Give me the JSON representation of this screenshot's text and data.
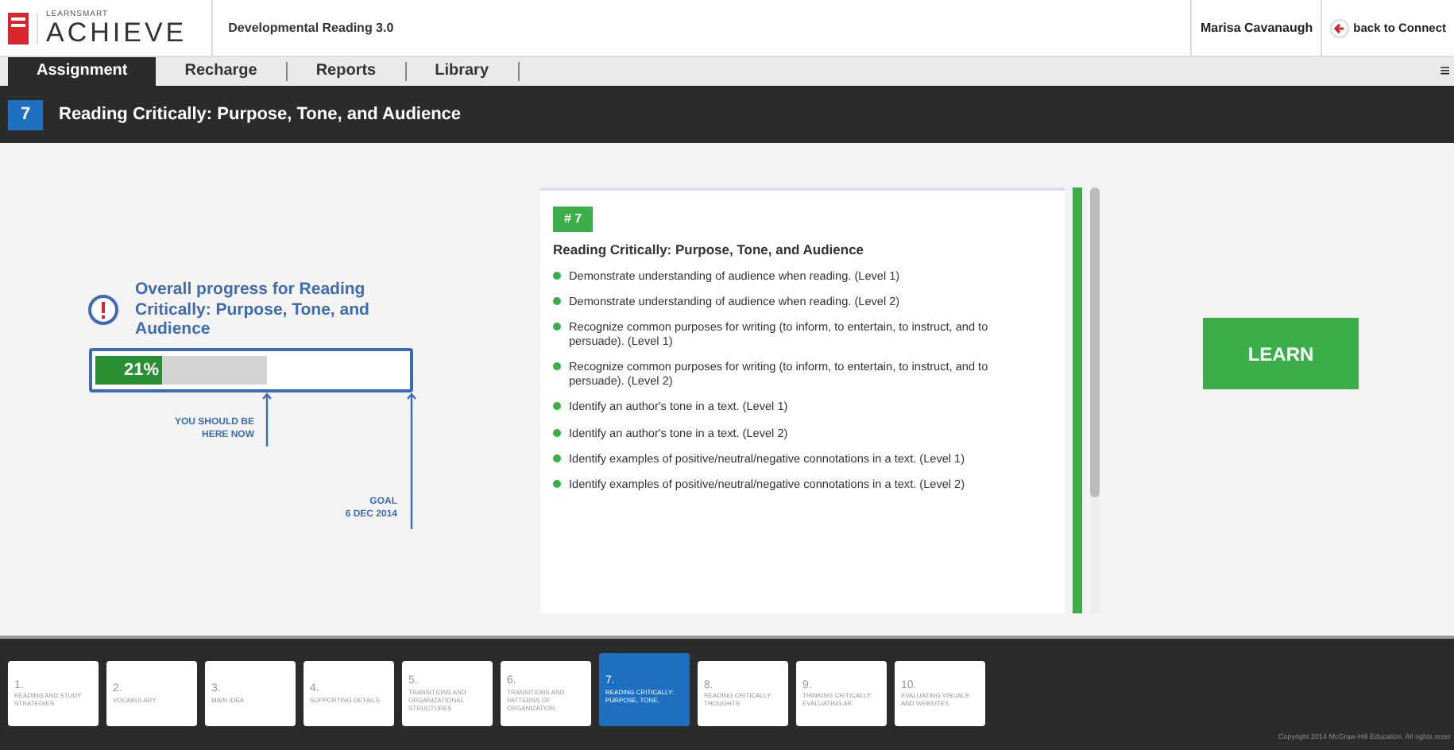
{
  "header": {
    "brand_small": "LEARNSMART",
    "brand": "ACHIEVE",
    "course": "Developmental Reading 3.0",
    "user": "Marisa Cavanaugh",
    "back_link": "back to Connect"
  },
  "tabs": [
    {
      "label": "Assignment",
      "selected": true
    },
    {
      "label": "Recharge",
      "selected": false
    },
    {
      "label": "Reports",
      "selected": false
    },
    {
      "label": "Library",
      "selected": false
    }
  ],
  "menu_icon": "≡",
  "title_bar": {
    "number": "7",
    "title": "Reading Critically: Purpose, Tone, and Audience"
  },
  "progress": {
    "heading": "Overall progress for Reading Critically: Purpose, Tone, and Audience",
    "label": "21%",
    "level": 0.21,
    "expected": {
      "level": 0.54,
      "label": "YOU SHOULD BE HERE NOW"
    },
    "goal": {
      "label": "GOAL",
      "date": "6 DEC 2014"
    }
  },
  "objectives": {
    "badge": "# 7",
    "title": "Reading Critically: Purpose, Tone, and Audience",
    "items": [
      "Demonstrate understanding of audience when reading. (Level 1)",
      "Demonstrate understanding of audience when reading. (Level 2)",
      "Recognize common purposes for writing (to inform, to entertain, to instruct, and to persuade). (Level 1)",
      "Recognize common purposes for writing (to inform, to entertain, to instruct, and to persuade). (Level 2)",
      "Identify an author's tone in a text. (Level 1)",
      "Identify an author's tone in a text. (Level 2)",
      "Identify examples of positive/neutral/negative connotations in a text. (Level 1)",
      "Identify examples of positive/neutral/negative connotations in a text. (Level 2)"
    ]
  },
  "learn_button": "LEARN",
  "chapters": [
    {
      "number": "1.",
      "title": "READING AND STUDY STRATEGIES",
      "selected": false
    },
    {
      "number": "2.",
      "title": "VOCABULARY",
      "selected": false
    },
    {
      "number": "3.",
      "title": "MAIN IDEA",
      "selected": false
    },
    {
      "number": "4.",
      "title": "SUPPORTING DETAILS",
      "selected": false
    },
    {
      "number": "5.",
      "title": "TRANSITIONS AND ORGANIZATIONAL STRUCTURES",
      "selected": false
    },
    {
      "number": "6.",
      "title": "TRANSITIONS AND PATTERNS OF ORGANIZATION",
      "selected": false
    },
    {
      "number": "7.",
      "title": "READING CRITICALLY: PURPOSE, TONE,",
      "selected": true
    },
    {
      "number": "8.",
      "title": "READING CRITICALLY: THOUGHTS",
      "selected": false
    },
    {
      "number": "9.",
      "title": "THINKING CRITICALLY: EVALUATING AR",
      "selected": false
    },
    {
      "number": "10.",
      "title": "EVALUATING VISUALS AND WEBSITES",
      "selected": false
    }
  ],
  "copyright": "Copyright 2014 McGraw-Hill Education. All rights reser"
}
